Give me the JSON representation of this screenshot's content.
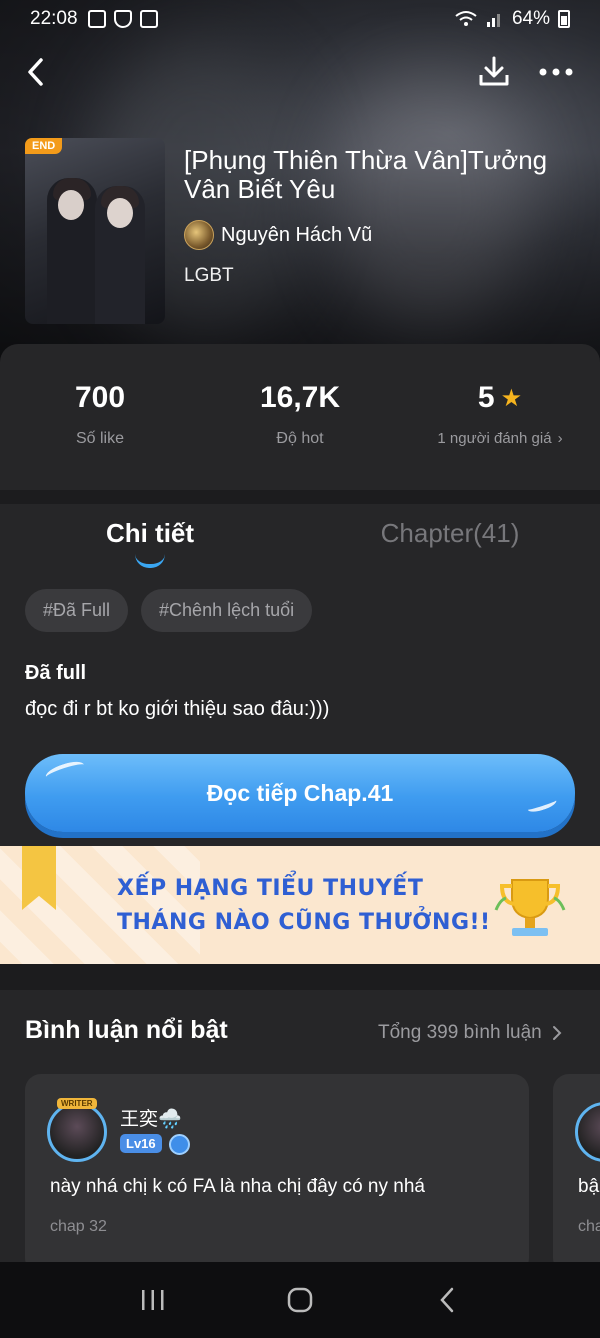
{
  "status_bar": {
    "time": "22:08",
    "battery": "64%"
  },
  "book": {
    "badge": "END",
    "title": "[Phụng Thiên Thừa Vân]Tưởng Vân Biết Yêu",
    "author": "Nguyên Hách Vũ",
    "genre": "LGBT"
  },
  "stats": {
    "likes_value": "700",
    "likes_label": "Số like",
    "hot_value": "16,7K",
    "hot_label": "Độ hot",
    "rating_value": "5",
    "rating_label": "1 người đánh giá"
  },
  "tabs": {
    "details": "Chi tiết",
    "chapters": "Chapter(41)"
  },
  "tags": [
    "#Đã Full",
    "#Chênh lệch tuổi"
  ],
  "description": {
    "title": "Đã full",
    "body": "đọc đi r bt ko giới thiệu sao đâu:)))"
  },
  "read_button": {
    "label": "Đọc tiếp Chap.41"
  },
  "banner": {
    "line1": "XẾP HẠNG TIỂU THUYẾT",
    "line2": "THÁNG NÀO CŨNG THƯỞNG!!"
  },
  "comments": {
    "heading": "Bình luận nổi bật",
    "total": "Tổng 399 bình luận",
    "items": [
      {
        "avatar_badge": "WRITER",
        "user": "王奕🌧️",
        "level": "Lv16",
        "text": "này nhá chị k có FA là nha chị đây có ny nhá",
        "chapter": "chap 32"
      },
      {
        "text": "bậ",
        "chapter": "cha"
      }
    ]
  },
  "colors": {
    "accent": "#3aa6f2",
    "star": "#f6b41e",
    "end_badge": "#f39b1a",
    "sheet_bg": "#262628"
  }
}
